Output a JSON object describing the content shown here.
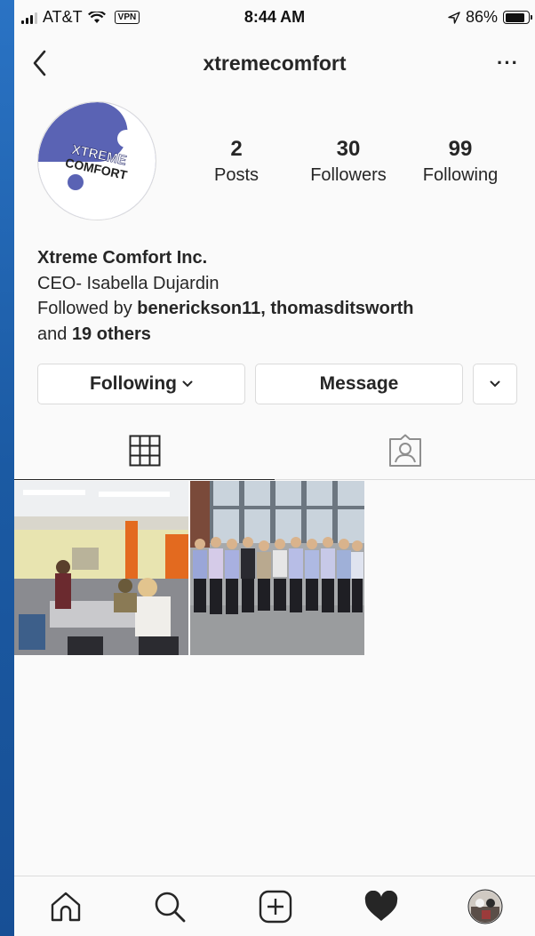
{
  "status_bar": {
    "carrier": "AT&T",
    "vpn": "VPN",
    "time": "8:44 AM",
    "battery": "86%",
    "battery_level": 0.86
  },
  "header": {
    "username": "xtremecomfort",
    "more": "···"
  },
  "avatar": {
    "logo_line1": "XTREME",
    "logo_line2": "COMFORT"
  },
  "stats": {
    "posts": {
      "value": "2",
      "label": "Posts"
    },
    "followers": {
      "value": "30",
      "label": "Followers"
    },
    "following": {
      "value": "99",
      "label": "Following"
    }
  },
  "bio": {
    "name": "Xtreme Comfort Inc.",
    "line": "CEO- Isabella Dujardin",
    "followed_by_prefix": "Followed by ",
    "followed_by_users": "benerickson11, thomasditsworth",
    "and_text": "and ",
    "others": "19 others"
  },
  "actions": {
    "following_label": "Following",
    "message_label": "Message"
  },
  "tabs": [
    "grid-icon",
    "tagged-icon"
  ],
  "posts": [
    "classroom-photo",
    "group-photo"
  ],
  "tabbar": [
    "home-icon",
    "search-icon",
    "add-icon",
    "activity-heart-icon",
    "profile-avatar"
  ],
  "colors": {
    "accent_frame": "#1d5fa8",
    "logo_blue": "#5a63b4",
    "text": "#262626",
    "border": "#dbdbdb"
  }
}
